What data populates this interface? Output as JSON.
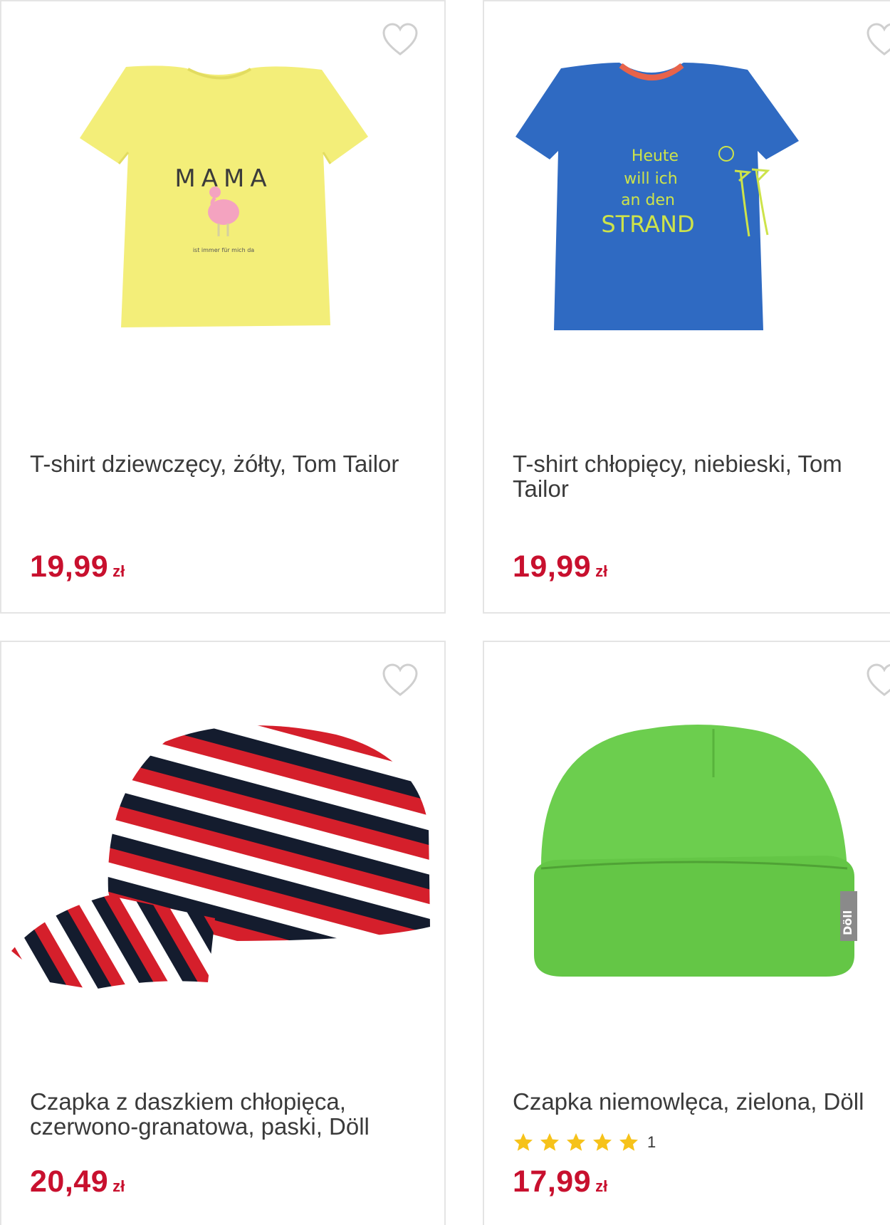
{
  "colors": {
    "price": "#c8102e",
    "title": "#3a3a3a",
    "star": "#f6c21a",
    "card_border": "#e4e4e4",
    "heart_outline": "#cfcfcf"
  },
  "products": [
    {
      "title": "T-shirt dziewczęcy, żółty, Tom Tailor",
      "price": "19,99",
      "currency": "zł",
      "image_icon": "yellow-tshirt-image",
      "print_text": "MAMA",
      "print_small": "ist immer für mich da"
    },
    {
      "title": "T-shirt chłopięcy, niebieski, Tom Tailor",
      "price": "19,99",
      "currency": "zł",
      "image_icon": "blue-tshirt-image",
      "print_lines": [
        "Heute",
        "will ich",
        "an den",
        "STRAND"
      ]
    },
    {
      "title": "Czapka z daszkiem chłopięca, czerwono-granatowa, paski, Döll",
      "price": "20,49",
      "currency": "zł",
      "image_icon": "striped-cap-image"
    },
    {
      "title": "Czapka niemowlęca, zielona, Döll",
      "price": "17,99",
      "currency": "zł",
      "image_icon": "green-beanie-image",
      "rating": 5,
      "rating_count": "1",
      "label_text": "Döll"
    }
  ]
}
